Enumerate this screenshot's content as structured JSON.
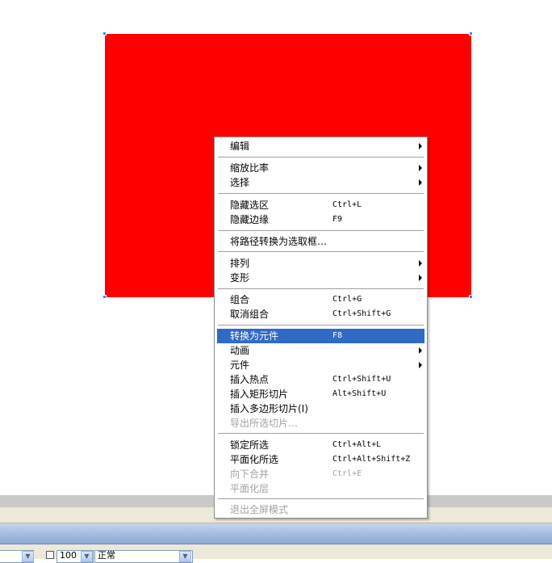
{
  "colors": {
    "shape_fill": "#ff0000",
    "menu_highlight": "#316ac5"
  },
  "context_menu": {
    "items": [
      {
        "label": "编辑",
        "shortcut": "",
        "submenu": true,
        "disabled": false
      },
      {
        "label": "缩放比率",
        "shortcut": "",
        "submenu": true,
        "disabled": false
      },
      {
        "label": "选择",
        "shortcut": "",
        "submenu": true,
        "disabled": false
      },
      {
        "label": "隐藏选区",
        "shortcut": "Ctrl+L",
        "submenu": false,
        "disabled": false
      },
      {
        "label": "隐藏边缘",
        "shortcut": "F9",
        "submenu": false,
        "disabled": false
      },
      {
        "label": "将路径转换为选取框…",
        "shortcut": "",
        "submenu": false,
        "disabled": false
      },
      {
        "label": "排列",
        "shortcut": "",
        "submenu": true,
        "disabled": false
      },
      {
        "label": "变形",
        "shortcut": "",
        "submenu": true,
        "disabled": false
      },
      {
        "label": "组合",
        "shortcut": "Ctrl+G",
        "submenu": false,
        "disabled": false
      },
      {
        "label": "取消组合",
        "shortcut": "Ctrl+Shift+G",
        "submenu": false,
        "disabled": false
      },
      {
        "label": "转换为元件",
        "shortcut": "F8",
        "submenu": false,
        "disabled": false,
        "highlighted": true
      },
      {
        "label": "动画",
        "shortcut": "",
        "submenu": true,
        "disabled": false
      },
      {
        "label": "元件",
        "shortcut": "",
        "submenu": true,
        "disabled": false
      },
      {
        "label": "插入热点",
        "shortcut": "Ctrl+Shift+U",
        "submenu": false,
        "disabled": false
      },
      {
        "label": "插入矩形切片",
        "shortcut": "Alt+Shift+U",
        "submenu": false,
        "disabled": false
      },
      {
        "label": "插入多边形切片(I)",
        "shortcut": "",
        "submenu": false,
        "disabled": false
      },
      {
        "label": "导出所选切片…",
        "shortcut": "",
        "submenu": false,
        "disabled": true
      },
      {
        "label": "锁定所选",
        "shortcut": "Ctrl+Alt+L",
        "submenu": false,
        "disabled": false
      },
      {
        "label": "平面化所选",
        "shortcut": "Ctrl+Alt+Shift+Z",
        "submenu": false,
        "disabled": false
      },
      {
        "label": "向下合并",
        "shortcut": "Ctrl+E",
        "submenu": false,
        "disabled": true
      },
      {
        "label": "平面化层",
        "shortcut": "",
        "submenu": false,
        "disabled": true
      },
      {
        "label": "退出全屏模式",
        "shortcut": "",
        "submenu": false,
        "disabled": true
      }
    ]
  },
  "toolbar": {
    "opacity_value": "100",
    "blend_mode": "正常"
  }
}
